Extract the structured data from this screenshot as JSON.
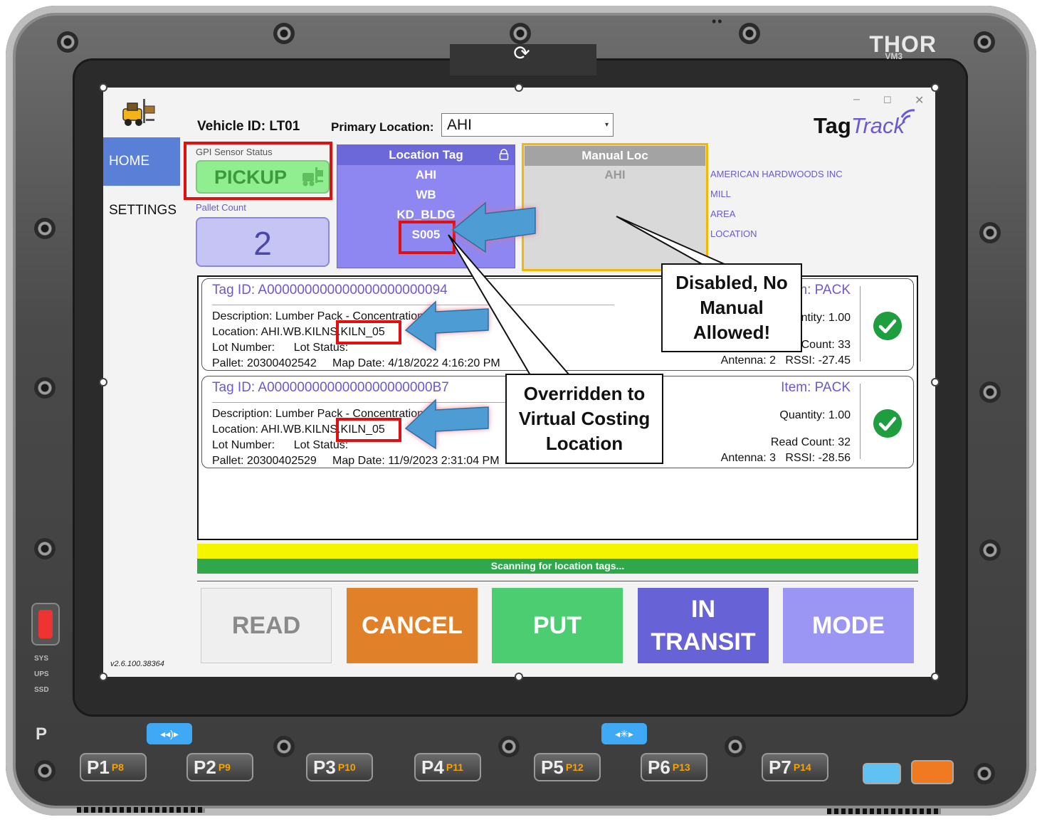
{
  "device": {
    "brand": "THOR",
    "model": "VM3",
    "left_indicators": [
      "SYS",
      "UPS",
      "SSD"
    ],
    "p_label": "P",
    "keys": [
      {
        "main": "P1",
        "sub": "P8"
      },
      {
        "main": "P2",
        "sub": "P9"
      },
      {
        "main": "P3",
        "sub": "P10"
      },
      {
        "main": "P4",
        "sub": "P11"
      },
      {
        "main": "P5",
        "sub": "P12"
      },
      {
        "main": "P6",
        "sub": "P13"
      },
      {
        "main": "P7",
        "sub": "P14"
      }
    ]
  },
  "app": {
    "logo": {
      "part1": "Tag",
      "part2": "Track"
    },
    "version": "v2.6.100.38364",
    "nav": {
      "home": "HOME",
      "settings": "SETTINGS"
    },
    "window_controls": {
      "minimize": "–",
      "maximize": "☐",
      "close": "✕"
    },
    "vehicle": {
      "label": "Vehicle ID: LT01"
    },
    "primary_location": {
      "label": "Primary Location:",
      "value": "AHI"
    },
    "gpi": {
      "label": "GPI Sensor Status",
      "status": "PICKUP"
    },
    "pallet": {
      "label": "Pallet Count",
      "count": "2"
    },
    "location_tag": {
      "title": "Location Tag",
      "rows": [
        "AHI",
        "WB",
        "KD_BLDG",
        "S005"
      ]
    },
    "manual_loc": {
      "title": "Manual Loc",
      "value": "AHI"
    },
    "location_names": [
      "AMERICAN HARDWOODS INC",
      "MILL",
      "AREA",
      "LOCATION"
    ],
    "tags": [
      {
        "tag_id": "Tag ID: A000000000000000000000094",
        "description": "Description: Lumber Pack - Concentration Yard",
        "location": "Location: AHI.WB.KILNS.KILN_05",
        "lot": "Lot Number:      Lot Status:",
        "pallet_map": "Pallet: 20300402542     Map Date: 4/18/2022 4:16:20 PM",
        "item": "Item: PACK",
        "quantity": "Quantity: 1.00",
        "read_count": "Read Count: 33",
        "antenna_rssi": "Antenna: 2   RSSI: -27.45"
      },
      {
        "tag_id": "Tag ID: A0000000000000000000000B7",
        "description": "Description: Lumber Pack - Concentration Yard",
        "location": "Location: AHI.WB.KILNS.KILN_05",
        "lot": "Lot Number:      Lot Status:",
        "pallet_map": "Pallet: 20300402529     Map Date: 11/9/2023 2:31:04 PM",
        "item": "Item: PACK",
        "quantity": "Quantity: 1.00",
        "read_count": "Read Count: 32",
        "antenna_rssi": "Antenna: 3   RSSI: -28.56"
      }
    ],
    "status_text": "Scanning for location tags...",
    "buttons": {
      "read": "READ",
      "cancel": "CANCEL",
      "put": "PUT",
      "in_transit": "IN TRANSIT",
      "mode": "MODE"
    },
    "colors": {
      "accent": "#6a5acd",
      "nav_active": "#5a7fd6",
      "status_yellow": "#f5f500",
      "status_green": "#2ea84a",
      "cancel": "#e0812a",
      "put": "#4dcd72",
      "in_transit": "#6762d6",
      "mode": "#9b96f4"
    }
  },
  "annotations": {
    "callout_manual": "Disabled, No Manual Allowed!",
    "callout_override": "Overridden to Virtual Costing Location"
  }
}
